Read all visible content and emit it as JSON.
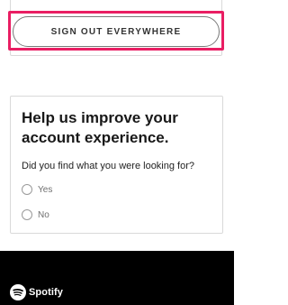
{
  "account": {
    "sign_out_label": "SIGN OUT EVERYWHERE"
  },
  "survey": {
    "title": "Help us improve your account experience.",
    "question": "Did you find what you were looking for?",
    "options": [
      {
        "label": "Yes",
        "selected": false
      },
      {
        "label": "No",
        "selected": false
      }
    ]
  },
  "footer": {
    "logo_icon": "spotify-icon",
    "logo_text": "Spotify"
  },
  "colors": {
    "highlight": "#e91e63",
    "footer_bg": "#000000"
  }
}
